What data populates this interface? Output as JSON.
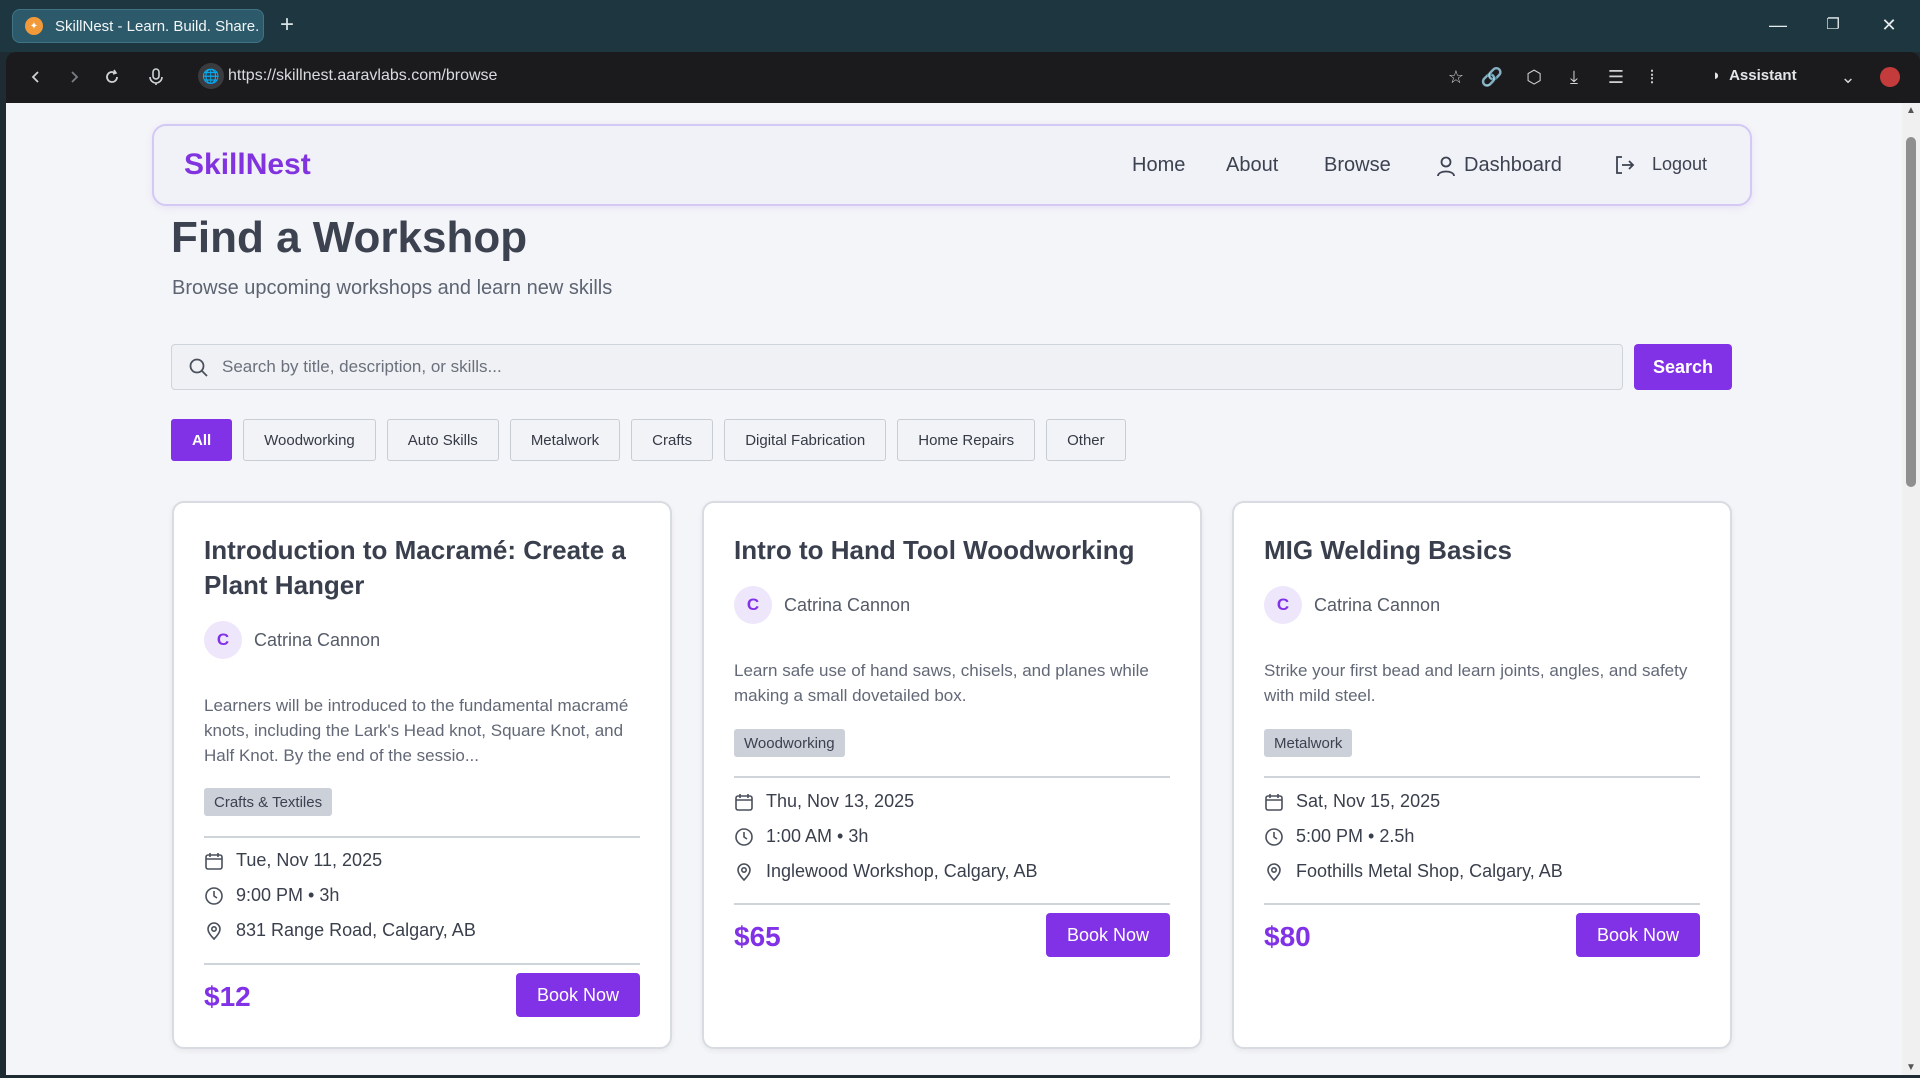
{
  "browser": {
    "tab_title": "SkillNest - Learn. Build. Share.",
    "url": "https://skillnest.aaravlabs.com/browse",
    "assistant_label": "Assistant"
  },
  "nav": {
    "brand": "SkillNest",
    "links": [
      "Home",
      "About",
      "Browse",
      "Dashboard",
      "Logout"
    ]
  },
  "header": {
    "title": "Find a Workshop",
    "subtitle": "Browse upcoming workshops and learn new skills"
  },
  "search": {
    "placeholder": "Search by title, description, or skills...",
    "button": "Search"
  },
  "filters": [
    "All",
    "Woodworking",
    "Auto Skills",
    "Metalwork",
    "Crafts",
    "Digital Fabrication",
    "Home Repairs",
    "Other"
  ],
  "active_filter": "All",
  "cards": [
    {
      "title": "Introduction to Macramé: Create a Plant Hanger",
      "instructor_initial": "C",
      "instructor": "Catrina Cannon",
      "description": "Learners will be introduced to the fundamental macramé knots, including the Lark's Head knot, Square Knot, and Half Knot. By the end of the sessio...",
      "tag": "Crafts & Textiles",
      "date": "Tue, Nov 11, 2025",
      "time": "9:00 PM • 3h",
      "location": "831 Range Road, Calgary, AB",
      "price": "$12",
      "button": "Book Now"
    },
    {
      "title": "Intro to Hand Tool Woodworking",
      "instructor_initial": "C",
      "instructor": "Catrina Cannon",
      "description": "Learn safe use of hand saws, chisels, and planes while making a small dovetailed box.",
      "tag": "Woodworking",
      "date": "Thu, Nov 13, 2025",
      "time": "1:00 AM • 3h",
      "location": "Inglewood Workshop, Calgary, AB",
      "price": "$65",
      "button": "Book Now"
    },
    {
      "title": "MIG Welding Basics",
      "instructor_initial": "C",
      "instructor": "Catrina Cannon",
      "description": "Strike your first bead and learn joints, angles, and safety with mild steel.",
      "tag": "Metalwork",
      "date": "Sat, Nov 15, 2025",
      "time": "5:00 PM • 2.5h",
      "location": "Foothills Metal Shop, Calgary, AB",
      "price": "$80",
      "button": "Book Now"
    }
  ],
  "colors": {
    "accent": "#8232e6",
    "titlebar": "#1d3640",
    "toolbar": "#1b1b1d",
    "page_bg": "#f4f5f8"
  },
  "icons": [
    "back-icon",
    "forward-icon",
    "reload-icon",
    "mic-icon",
    "globe-icon",
    "star-icon",
    "link-icon",
    "extensions-icon",
    "download-icon",
    "menu-icon",
    "audio-icon",
    "assistant-icon",
    "chevron-down-icon",
    "user-icon",
    "logout-icon",
    "search-icon",
    "calendar-icon",
    "clock-icon",
    "pin-icon"
  ]
}
